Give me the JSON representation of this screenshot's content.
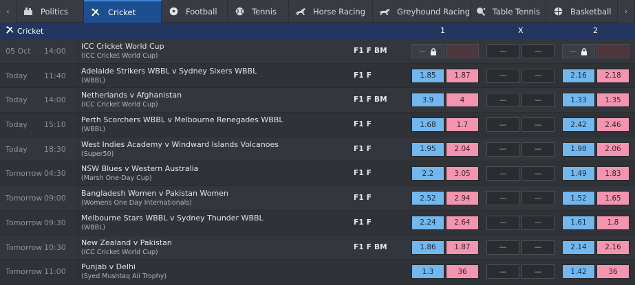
{
  "tabs": [
    {
      "label": "Politics",
      "icon": "politics-icon",
      "active": false
    },
    {
      "label": "Cricket",
      "icon": "cricket-icon",
      "active": true
    },
    {
      "label": "Football",
      "icon": "football-icon",
      "active": false
    },
    {
      "label": "Tennis",
      "icon": "tennis-icon",
      "active": false
    },
    {
      "label": "Horse Racing",
      "icon": "horse-racing-icon",
      "active": false
    },
    {
      "label": "Greyhound Racing",
      "icon": "greyhound-icon",
      "active": false
    },
    {
      "label": "Table Tennis",
      "icon": "table-tennis-icon",
      "active": false
    },
    {
      "label": "Basketball",
      "icon": "basketball-icon",
      "active": false
    }
  ],
  "nav": {
    "prev": "‹",
    "next": "›"
  },
  "header": {
    "title": "Cricket",
    "col1": "1",
    "colx": "X",
    "col2": "2"
  },
  "rows": [
    {
      "day": "05 Oct",
      "time": "14:00",
      "match": "ICC Cricket World Cup",
      "comp": "(ICC Cricket World Cup)",
      "flags": "F1 F BM",
      "b1": "—",
      "l1": "",
      "bx": "—",
      "lx": "—",
      "b2": "—",
      "l2": "",
      "locked": true
    },
    {
      "day": "Today",
      "time": "11:40",
      "match": "Adelaide Strikers WBBL v Sydney Sixers WBBL",
      "comp": "(WBBL)",
      "flags": "F1 F",
      "b1": "1.85",
      "l1": "1.87",
      "bx": "—",
      "lx": "—",
      "b2": "2.16",
      "l2": "2.18",
      "locked": false
    },
    {
      "day": "Today",
      "time": "14:00",
      "match": "Netherlands v Afghanistan",
      "comp": "(ICC Cricket World Cup)",
      "flags": "F1 F BM",
      "b1": "3.9",
      "l1": "4",
      "bx": "—",
      "lx": "—",
      "b2": "1.33",
      "l2": "1.35",
      "locked": false
    },
    {
      "day": "Today",
      "time": "15:10",
      "match": "Perth Scorchers WBBL v Melbourne Renegades WBBL",
      "comp": "(WBBL)",
      "flags": "F1 F",
      "b1": "1.68",
      "l1": "1.7",
      "bx": "—",
      "lx": "—",
      "b2": "2.42",
      "l2": "2.46",
      "locked": false
    },
    {
      "day": "Today",
      "time": "18:30",
      "match": "West Indies Academy v Windward Islands Volcanoes",
      "comp": "(Super50)",
      "flags": "F1 F",
      "b1": "1.95",
      "l1": "2.04",
      "bx": "—",
      "lx": "—",
      "b2": "1.98",
      "l2": "2.06",
      "locked": false
    },
    {
      "day": "Tomorrow",
      "time": "04:30",
      "match": "NSW Blues v Western Australia",
      "comp": "(Marsh One-Day Cup)",
      "flags": "F1 F",
      "b1": "2.2",
      "l1": "3.05",
      "bx": "—",
      "lx": "—",
      "b2": "1.49",
      "l2": "1.83",
      "locked": false
    },
    {
      "day": "Tomorrow",
      "time": "09:00",
      "match": "Bangladesh Women v Pakistan Women",
      "comp": "(Womens One Day Internationals)",
      "flags": "F1 F",
      "b1": "2.52",
      "l1": "2.94",
      "bx": "—",
      "lx": "—",
      "b2": "1.52",
      "l2": "1.65",
      "locked": false
    },
    {
      "day": "Tomorrow",
      "time": "09:30",
      "match": "Melbourne Stars WBBL v Sydney Thunder WBBL",
      "comp": "(WBBL)",
      "flags": "F1 F",
      "b1": "2.24",
      "l1": "2.64",
      "bx": "—",
      "lx": "—",
      "b2": "1.61",
      "l2": "1.8",
      "locked": false
    },
    {
      "day": "Tomorrow",
      "time": "10:30",
      "match": "New Zealand v Pakistan",
      "comp": "(ICC Cricket World Cup)",
      "flags": "F1 F BM",
      "b1": "1.86",
      "l1": "1.87",
      "bx": "—",
      "lx": "—",
      "b2": "2.14",
      "l2": "2.16",
      "locked": false
    },
    {
      "day": "Tomorrow",
      "time": "11:00",
      "match": "Punjab v Delhi",
      "comp": "(Syed Mushtaq Ali Trophy)",
      "flags": "",
      "b1": "1.3",
      "l1": "36",
      "bx": "—",
      "lx": "—",
      "b2": "1.42",
      "l2": "36",
      "locked": false
    }
  ]
}
